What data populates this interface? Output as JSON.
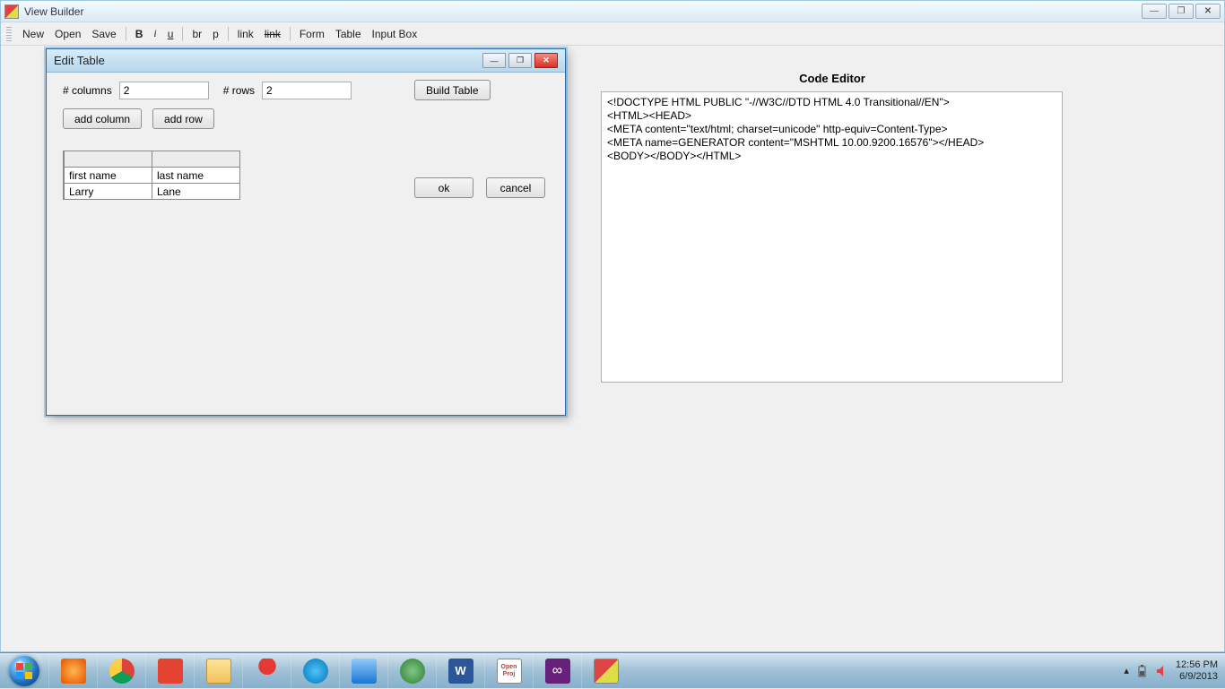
{
  "window": {
    "title": "View Builder",
    "min_glyph": "—",
    "max_glyph": "❐",
    "close_glyph": "✕"
  },
  "toolbar": {
    "new": "New",
    "open": "Open",
    "save": "Save",
    "bold": "B",
    "italic": "i",
    "underline": "u",
    "br": "br",
    "p": "p",
    "link": "link",
    "strike_link": "link",
    "form": "Form",
    "table": "Table",
    "input_box": "Input Box"
  },
  "code_editor": {
    "title": "Code Editor",
    "content": "<!DOCTYPE HTML PUBLIC \"-//W3C//DTD HTML 4.0 Transitional//EN\">\n<HTML><HEAD>\n<META content=\"text/html; charset=unicode\" http-equiv=Content-Type>\n<META name=GENERATOR content=\"MSHTML 10.00.9200.16576\"></HEAD>\n<BODY></BODY></HTML>"
  },
  "dialog": {
    "title": "Edit Table",
    "cols_label": "# columns",
    "cols_value": "2",
    "rows_label": "# rows",
    "rows_value": "2",
    "build": "Build Table",
    "add_column": "add column",
    "add_row": "add row",
    "ok": "ok",
    "cancel": "cancel",
    "table": {
      "r0c0": "first name",
      "r0c1": "last name",
      "r1c0": "Larry",
      "r1c1": "Lane"
    },
    "min_glyph": "—",
    "max_glyph": "❐",
    "close_glyph": "✕"
  },
  "tray": {
    "up_glyph": "▴",
    "time": "12:56 PM",
    "date": "6/9/2013"
  }
}
